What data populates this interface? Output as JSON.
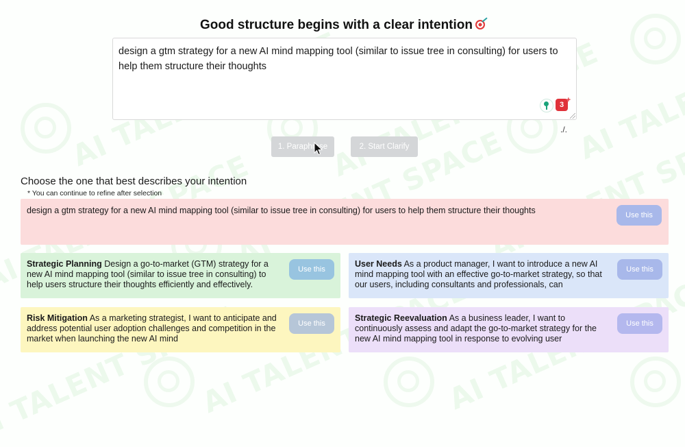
{
  "page": {
    "title": "Good structure begins with a clear intention",
    "title_icon": "target-icon"
  },
  "prompt": {
    "text": "design a gtm strategy for a new AI mind mapping tool (similar to issue tree in consulting) for users to\nhelp them structure their thoughts",
    "extension_icons": [
      "lightbulb-extension-icon",
      "red-extension-icon"
    ],
    "red_extension_badge": "3",
    "trailing_mark": "./."
  },
  "actions": {
    "paraphrase_label": "1. Paraphrase",
    "clarify_label": "2. Start Clarify"
  },
  "choices": {
    "heading": "Choose the one that best describes your intention",
    "note": "* You can continue to refine after selection",
    "use_label": "Use this",
    "original": {
      "text": "design a gtm strategy for a new AI mind mapping tool (similar to issue tree in consulting) for users to help them structure their thoughts"
    },
    "options": [
      {
        "title": "Strategic Planning",
        "text": "Design a go-to-market (GTM) strategy for a new AI mind mapping tool (similar to issue tree in consulting) to help users structure their thoughts efficiently and effectively.",
        "color": "#d9f3da"
      },
      {
        "title": "User Needs",
        "text": "As a product manager, I want to introduce a new AI mind mapping tool with an effective go-to-market strategy, so that our users, including consultants and professionals, can",
        "color": "#dae6f9"
      },
      {
        "title": "Risk Mitigation",
        "text": "As a marketing strategist, I want to anticipate and address potential user adoption challenges and competition in the market when launching the new AI mind",
        "color": "#fdf6bf"
      },
      {
        "title": "Strategic Reevaluation",
        "text": "As a business leader, I want to continuously assess and adapt the go-to-market strategy for the new AI mind mapping tool in response to evolving user",
        "color": "#ecdff9"
      }
    ]
  },
  "watermark": {
    "text": "AI TALENT SPACE",
    "color": "#96d796"
  }
}
